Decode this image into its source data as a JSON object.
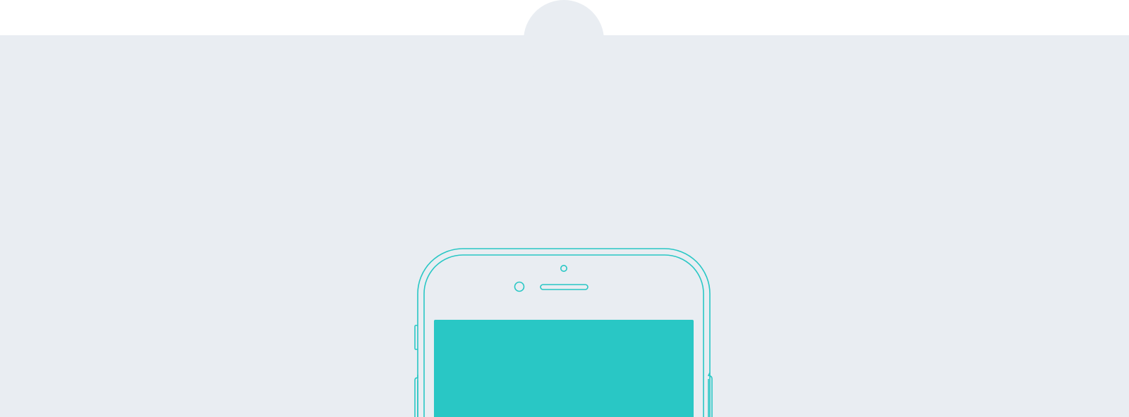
{
  "theme": {
    "background_color": "#e9edf2",
    "top_strip_color": "#ffffff",
    "accent_color": "#29c7c5"
  },
  "illustration": {
    "icon": "smartphone-outline-icon",
    "screen_fill": "solid-teal"
  }
}
